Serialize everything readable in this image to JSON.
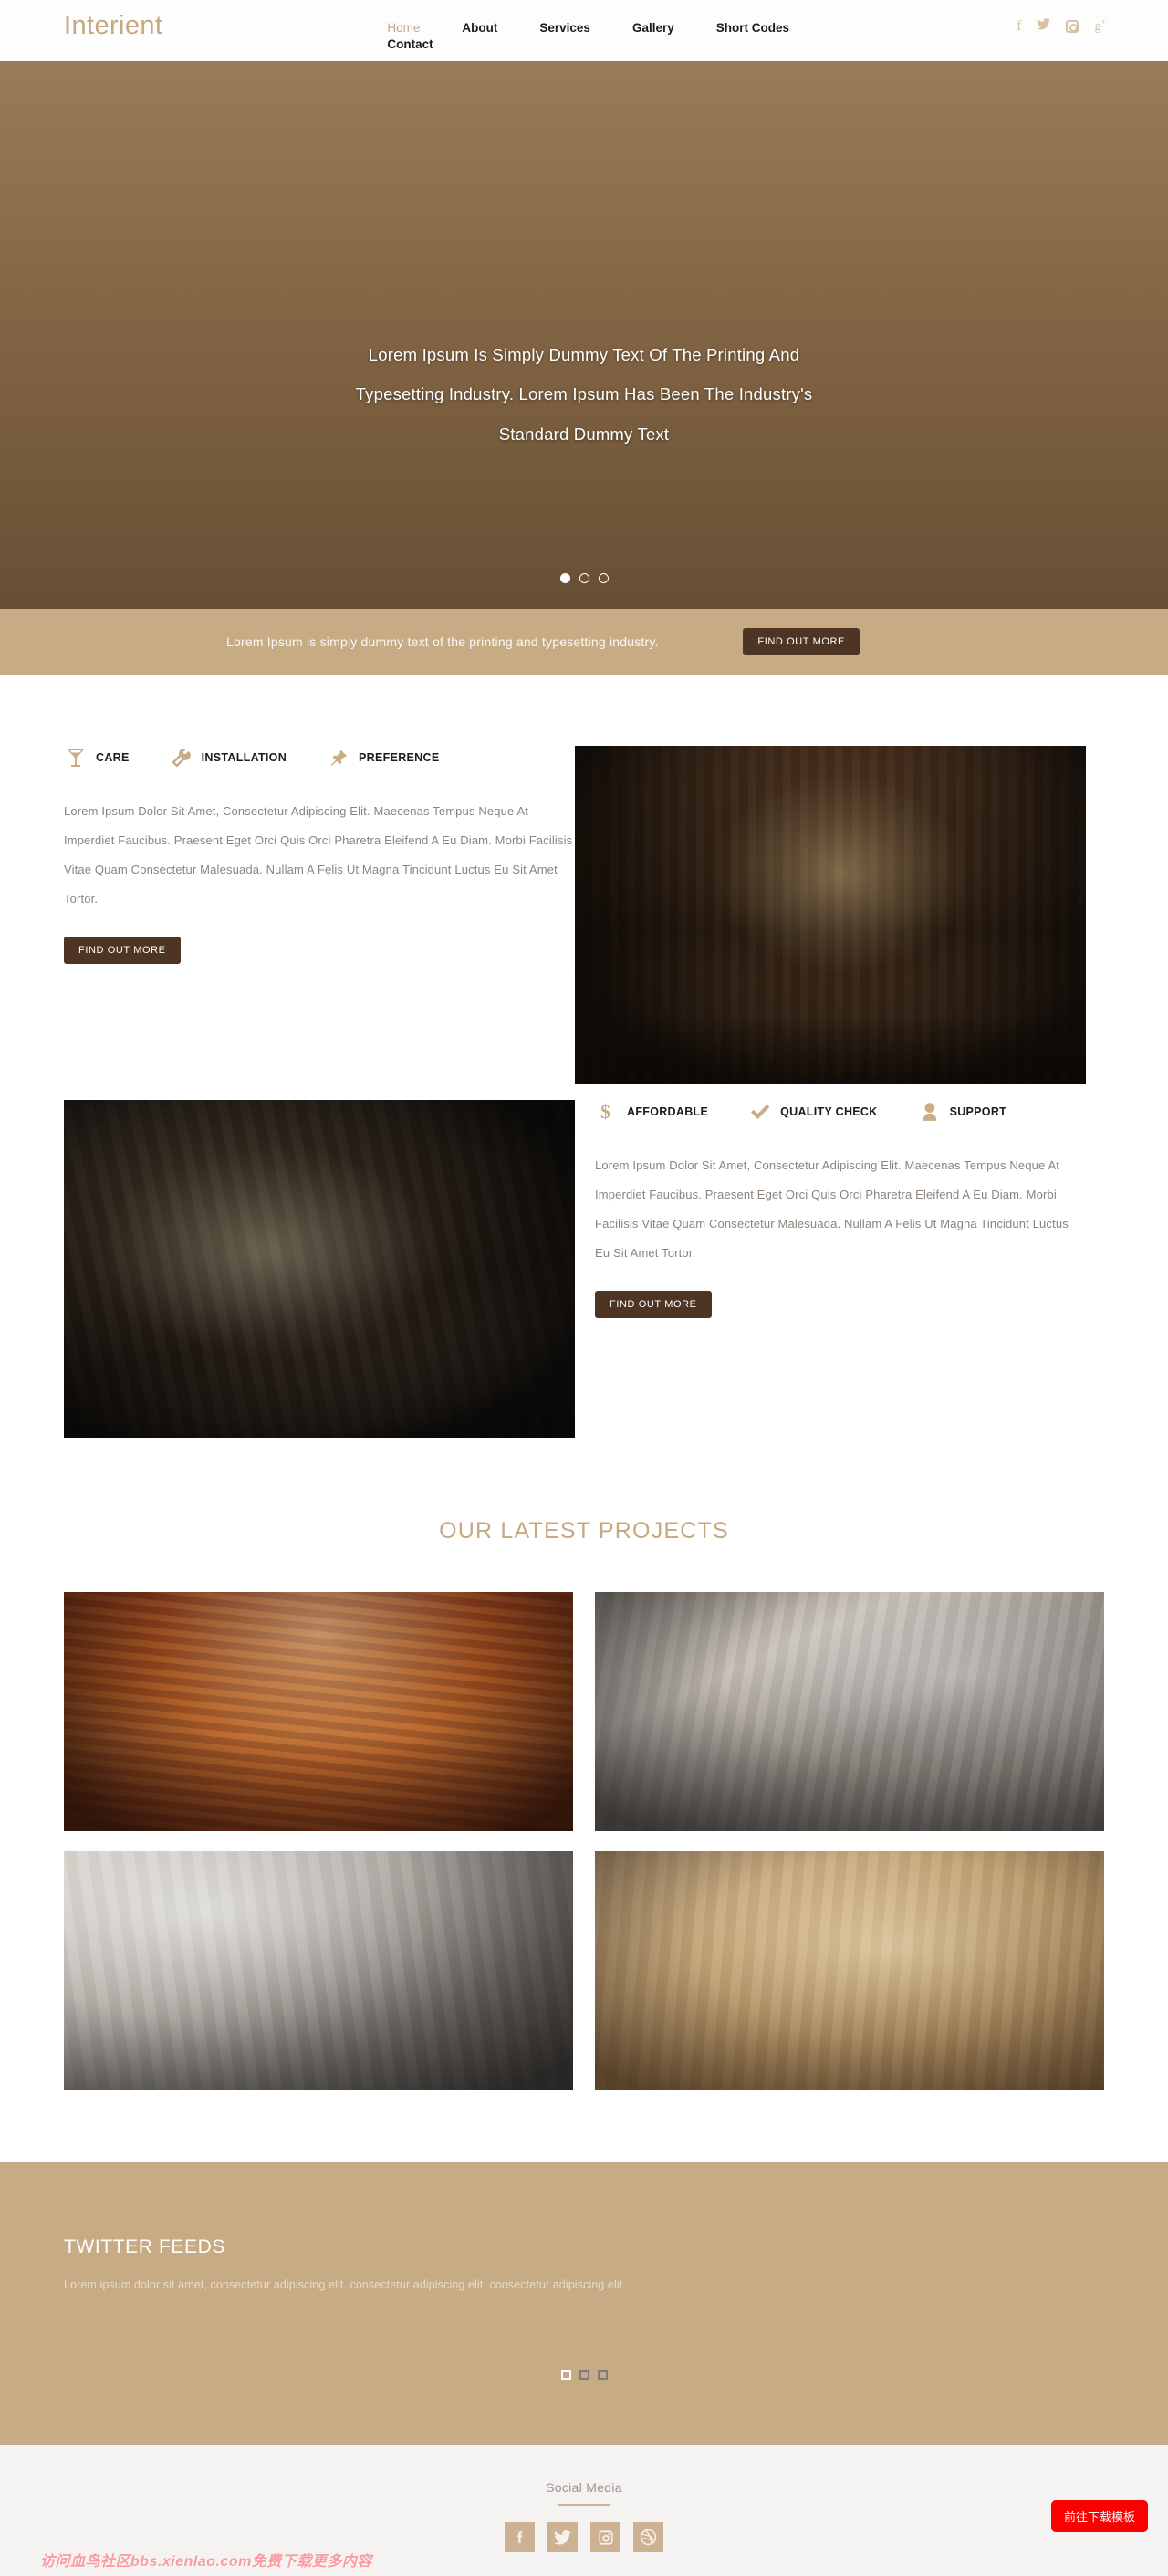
{
  "site": {
    "logo": "Interient",
    "accent": "#c5a87e",
    "dark_button": "#4e3423",
    "tan_band": "#c7ab85"
  },
  "nav": {
    "items": [
      {
        "label": "Home",
        "active": true
      },
      {
        "label": "About",
        "active": false
      },
      {
        "label": "Services",
        "active": false
      },
      {
        "label": "Gallery",
        "active": false
      },
      {
        "label": "Short Codes",
        "active": false
      },
      {
        "label": "Contact",
        "active": false
      }
    ],
    "social": [
      "facebook-icon",
      "twitter-icon",
      "instagram-icon",
      "googleplus-icon"
    ],
    "social_labels": [
      "f",
      "ᵇ",
      "",
      "g"
    ]
  },
  "hero": {
    "caption_line1": "Lorem Ipsum Is Simply Dummy Text Of The Printing And",
    "caption_line2": "Typesetting Industry. Lorem Ipsum Has Been The Industry's",
    "caption_line3": "Standard Dummy Text",
    "dots_total": 3,
    "dot_active_index": 0
  },
  "tagline": {
    "text": "Lorem Ipsum is simply dummy text of the printing and typesetting industry.",
    "button": "FIND OUT MORE"
  },
  "features": {
    "block_one": {
      "services": [
        {
          "label": "CARE",
          "icon": "martini-glass-icon"
        },
        {
          "label": "INSTALLATION",
          "icon": "wrench-icon"
        },
        {
          "label": "PREFERENCE",
          "icon": "pushpin-icon"
        }
      ],
      "paragraph": "Lorem Ipsum Dolor Sit Amet, Consectetur Adipiscing Elit. Maecenas Tempus Neque At Imperdiet Faucibus. Praesent Eget Orci Quis Orci Pharetra Eleifend A Eu Diam. Morbi Facilisis Vitae Quam Consectetur Malesuada. Nullam A Felis Ut Magna Tincidunt Luctus Eu Sit Amet Tortor.",
      "button": "FIND OUT MORE",
      "image_alt": "restaurant-interior-photo"
    },
    "block_two": {
      "services": [
        {
          "label": "AFFORDABLE",
          "icon": "dollar-sign-icon"
        },
        {
          "label": "QUALITY CHECK",
          "icon": "check-mark-icon"
        },
        {
          "label": "SUPPORT",
          "icon": "user-icon"
        }
      ],
      "paragraph": "Lorem Ipsum Dolor Sit Amet, Consectetur Adipiscing Elit. Maecenas Tempus Neque At Imperdiet Faucibus. Praesent Eget Orci Quis Orci Pharetra Eleifend A Eu Diam. Morbi Facilisis Vitae Quam Consectetur Malesuada. Nullam A Felis Ut Magna Tincidunt Luctus Eu Sit Amet Tortor.",
      "button": "FIND OUT MORE",
      "image_alt": "conference-room-photo"
    }
  },
  "projects": {
    "title": "OUR LATEST PROJECTS",
    "items": [
      {
        "alt": "theater-auditorium-project"
      },
      {
        "alt": "bedroom-with-guitar-project"
      },
      {
        "alt": "white-bedroom-project"
      },
      {
        "alt": "lobby-corridor-project"
      }
    ]
  },
  "twitter": {
    "title": "TWITTER FEEDS",
    "text": "Lorem ipsum dolor sit amet, consectetur adipiscing elit. consectetur adipiscing elit. consectetur adipiscing elit.",
    "dots_total": 3,
    "dot_active_index": 0
  },
  "footer": {
    "heading": "Social Media",
    "socials": [
      {
        "name": "facebook-icon"
      },
      {
        "name": "twitter-icon"
      },
      {
        "name": "instagram-icon"
      },
      {
        "name": "dribbble-icon"
      }
    ]
  },
  "overlay": {
    "watermark": "访问血鸟社区bbs.xienlao.com免费下载更多内容",
    "download_button": "前往下载模板"
  }
}
